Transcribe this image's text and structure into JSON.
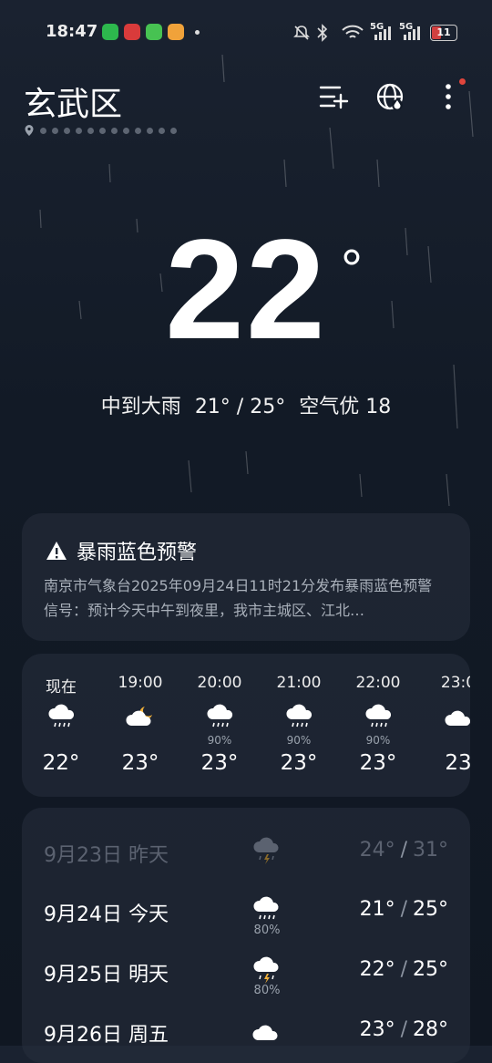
{
  "status_bar": {
    "time": "18:47",
    "network_1": "5G",
    "network_2": "5G",
    "battery": "11"
  },
  "header": {
    "city": "玄武区",
    "icons": [
      "list-add-icon",
      "globe-icon",
      "more-vertical-icon"
    ]
  },
  "current": {
    "temperature": "22",
    "degree_symbol": "°",
    "condition": "中到大雨",
    "range": "21° / 25°",
    "air_quality": "空气优 18"
  },
  "alert": {
    "title": "暴雨蓝色预警",
    "body": "南京市气象台2025年09月24日11时21分发布暴雨蓝色预警信号：预计今天中午到夜里，我市主城区、江北…"
  },
  "hourly": [
    {
      "time": "现在",
      "icon": "cloud-rain-icon",
      "precip": "",
      "temp": "22°"
    },
    {
      "time": "19:00",
      "icon": "cloud-moon-icon",
      "precip": "",
      "temp": "23°"
    },
    {
      "time": "20:00",
      "icon": "cloud-rain-icon",
      "precip": "90%",
      "temp": "23°"
    },
    {
      "time": "21:00",
      "icon": "cloud-rain-icon",
      "precip": "90%",
      "temp": "23°"
    },
    {
      "time": "22:00",
      "icon": "cloud-rain-icon",
      "precip": "90%",
      "temp": "23°"
    },
    {
      "time": "23:0",
      "icon": "cloud-icon",
      "precip": "",
      "temp": "23"
    }
  ],
  "daily": [
    {
      "date": "9月23日  昨天",
      "icon": "thunderstorm-icon",
      "precip": "",
      "low": "24°",
      "high": "31°",
      "past": true
    },
    {
      "date": "9月24日  今天",
      "icon": "cloud-rain-icon",
      "precip": "80%",
      "low": "21°",
      "high": "25°",
      "past": false
    },
    {
      "date": "9月25日  明天",
      "icon": "thunderstorm-icon",
      "precip": "80%",
      "low": "22°",
      "high": "25°",
      "past": false
    },
    {
      "date": "9月26日  周五",
      "icon": "cloud-icon",
      "precip": "",
      "low": "23°",
      "high": "28°",
      "past": false
    }
  ],
  "colors": {
    "background": "#121a26",
    "card": "#283040",
    "accent_red": "#e0453c",
    "sun_yellow": "#f2b13a"
  }
}
